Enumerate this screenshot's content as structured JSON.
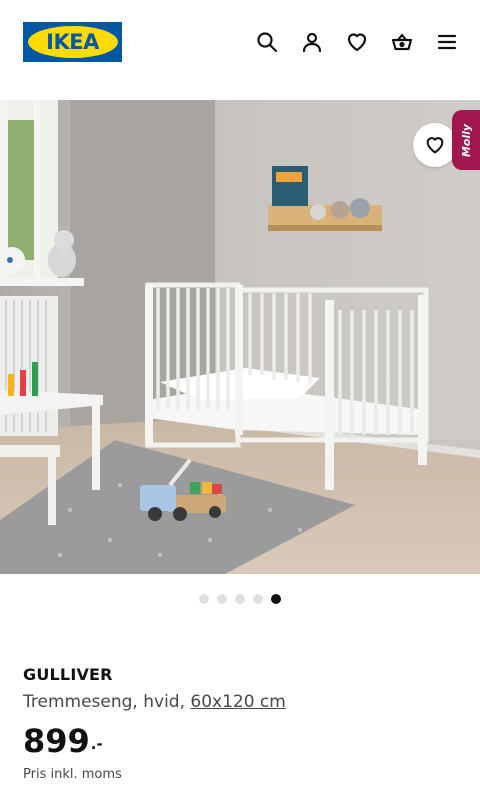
{
  "header": {
    "logo_text": "IKEA",
    "icons": [
      "search-icon",
      "user-icon",
      "heart-icon",
      "basket-icon",
      "menu-icon"
    ]
  },
  "colors": {
    "ikea_blue": "#0058a3",
    "ikea_yellow": "#ffdb00",
    "mobly_accent": "#a2154f"
  },
  "carousel": {
    "total_slides": 5,
    "active_slide": 5,
    "mobly_label": "Molly"
  },
  "product": {
    "name": "GULLIVER",
    "description_prefix": "Tremmeseng, hvid, ",
    "size": "60x120 cm",
    "price_integer": "899",
    "price_suffix": ".-",
    "vat_note": "Pris inkl. moms"
  }
}
